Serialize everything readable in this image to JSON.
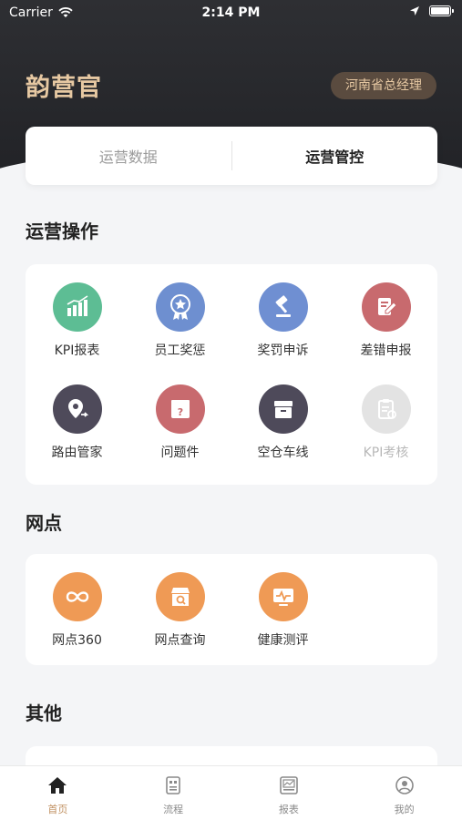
{
  "status_bar": {
    "carrier": "Carrier",
    "time": "2:14 PM"
  },
  "header": {
    "title": "韵营官",
    "role": "河南省总经理"
  },
  "segment": {
    "tab1": "运营数据",
    "tab2": "运营管控",
    "active": "运营管控"
  },
  "sections": {
    "operations": {
      "title": "运营操作",
      "items": [
        {
          "label": "KPI报表",
          "icon": "bar-chart-icon",
          "color": "#5dbd94"
        },
        {
          "label": "员工奖惩",
          "icon": "medal-icon",
          "color": "#6e8fd0"
        },
        {
          "label": "奖罚申诉",
          "icon": "gavel-icon",
          "color": "#6f8fd2"
        },
        {
          "label": "差错申报",
          "icon": "edit-doc-icon",
          "color": "#c86a6e"
        },
        {
          "label": "路由管家",
          "icon": "location-pin-icon",
          "color": "#4e4a5a"
        },
        {
          "label": "问题件",
          "icon": "question-box-icon",
          "color": "#c86a6e"
        },
        {
          "label": "空仓车线",
          "icon": "archive-box-icon",
          "color": "#4e4a5a"
        },
        {
          "label": "KPI考核",
          "icon": "clipboard-icon",
          "color": "#e3e3e3"
        }
      ]
    },
    "outlets": {
      "title": "网点",
      "items": [
        {
          "label": "网点360",
          "icon": "infinity-icon",
          "color": "#ef9a55"
        },
        {
          "label": "网点查询",
          "icon": "storefront-icon",
          "color": "#ef9a55"
        },
        {
          "label": "健康测评",
          "icon": "monitor-pulse-icon",
          "color": "#ef9a55"
        }
      ]
    },
    "other": {
      "title": "其他"
    }
  },
  "tabbar": [
    {
      "label": "首页",
      "icon": "home-icon",
      "active": true
    },
    {
      "label": "流程",
      "icon": "process-icon",
      "active": false
    },
    {
      "label": "报表",
      "icon": "report-icon",
      "active": false
    },
    {
      "label": "我的",
      "icon": "profile-icon",
      "active": false
    }
  ],
  "colors": {
    "accent": "#c09060",
    "header_bg": "#2e2f33",
    "badge_text": "#e7c9a3"
  }
}
